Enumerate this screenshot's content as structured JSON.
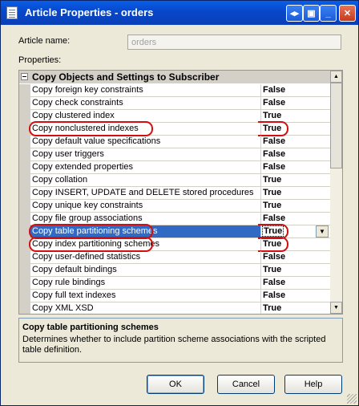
{
  "window": {
    "title": "Article Properties - orders",
    "controls": [
      "restore-icon",
      "pin-icon",
      "minimize-icon",
      "maximize-icon",
      "close-icon"
    ]
  },
  "article_name": {
    "label": "Article name:",
    "value": "orders"
  },
  "properties_label": "Properties:",
  "grid": {
    "category": "Copy Objects and Settings to Subscriber",
    "rows": [
      {
        "name": "Copy foreign key constraints",
        "value": "False"
      },
      {
        "name": "Copy check constraints",
        "value": "False"
      },
      {
        "name": "Copy clustered index",
        "value": "True"
      },
      {
        "name": "Copy nonclustered indexes",
        "value": "True"
      },
      {
        "name": "Copy default value specifications",
        "value": "False"
      },
      {
        "name": "Copy user triggers",
        "value": "False"
      },
      {
        "name": "Copy extended properties",
        "value": "False"
      },
      {
        "name": "Copy collation",
        "value": "True"
      },
      {
        "name": "Copy INSERT, UPDATE and DELETE stored procedures",
        "value": "True"
      },
      {
        "name": "Copy unique key constraints",
        "value": "True"
      },
      {
        "name": "Copy file group associations",
        "value": "False"
      },
      {
        "name": "Copy table partitioning schemes",
        "value": "True"
      },
      {
        "name": "Copy index partitioning schemes",
        "value": "True"
      },
      {
        "name": "Copy user-defined statistics",
        "value": "False"
      },
      {
        "name": "Copy default bindings",
        "value": "True"
      },
      {
        "name": "Copy rule bindings",
        "value": "False"
      },
      {
        "name": "Copy full text indexes",
        "value": "False"
      },
      {
        "name": "Copy XML XSD",
        "value": "True"
      }
    ]
  },
  "description": {
    "title": "Copy table partitioning schemes",
    "text": "Determines whether to include partition scheme associations with the scripted table definition."
  },
  "buttons": {
    "ok": "OK",
    "cancel": "Cancel",
    "help": "Help"
  },
  "colors": {
    "titlebar": "#0747c9",
    "selection": "#316ac5",
    "highlight_oval": "#d01010"
  }
}
